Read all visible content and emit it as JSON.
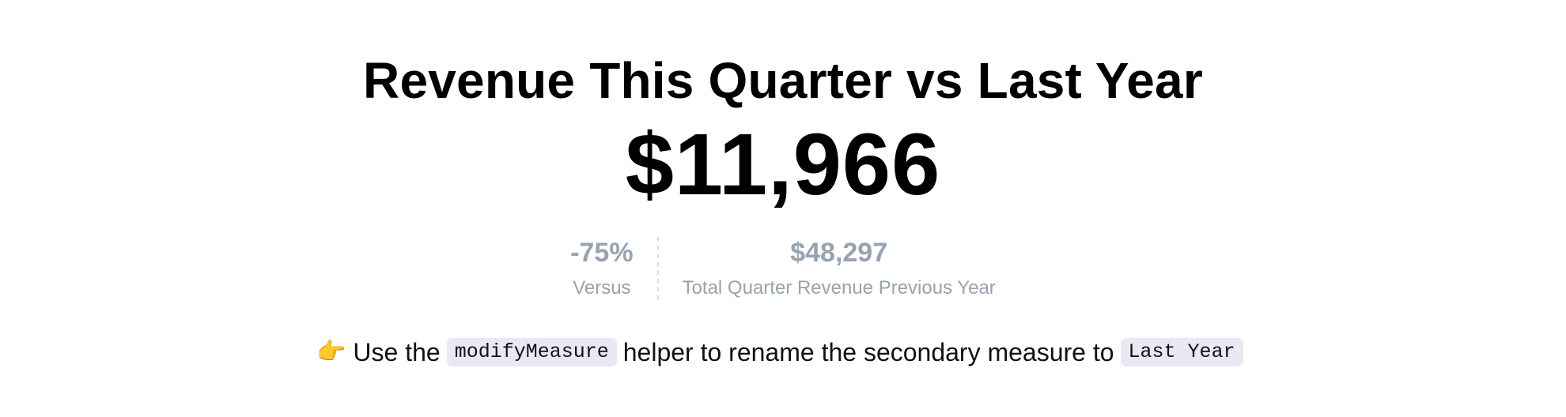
{
  "widget": {
    "title": "Revenue This Quarter vs Last Year",
    "primary_value": "$11,966",
    "comparison": {
      "change_value": "-75%",
      "change_label": "Versus",
      "previous_value": "$48,297",
      "previous_label": "Total Quarter Revenue Previous Year"
    }
  },
  "hint": {
    "emoji": "👉",
    "emoji_icon": "pointing-hand-icon",
    "text_before": "Use the",
    "code_1": "modifyMeasure",
    "text_middle": "helper to rename the secondary measure to",
    "code_2": "Last Year"
  },
  "colors": {
    "muted": "#97a3b0",
    "code_background": "#e9e8f5",
    "divider": "#d7dce2"
  }
}
